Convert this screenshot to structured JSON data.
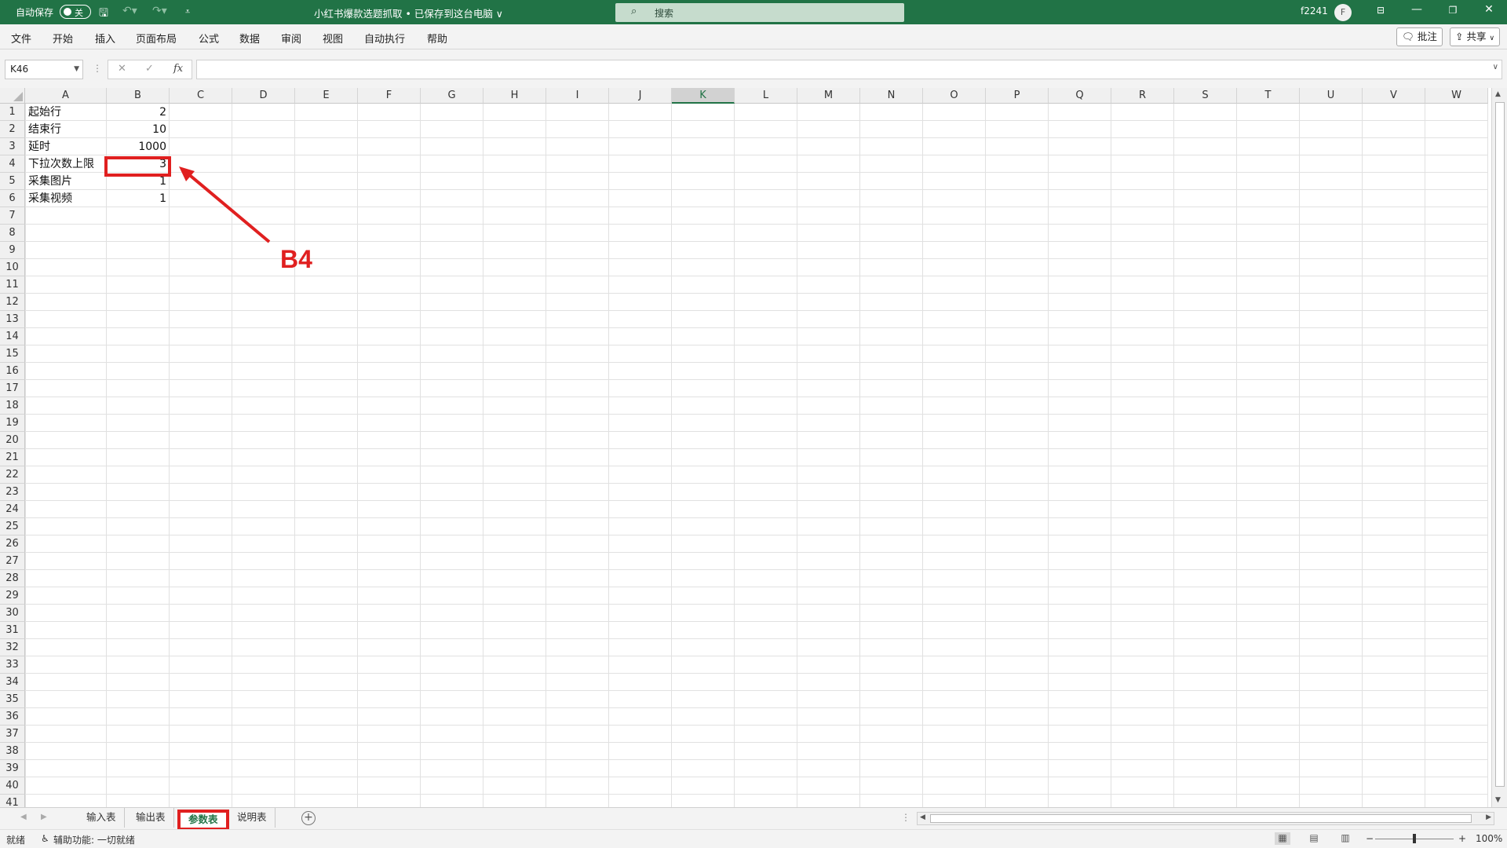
{
  "titlebar": {
    "autosave_label": "自动保存",
    "autosave_state": "关",
    "doc_title": "小红书爆款选题抓取 • 已保存到这台电脑 ∨",
    "search_placeholder": "搜索",
    "user": "f2241",
    "avatar_initial": "F"
  },
  "ribbon": {
    "tabs": [
      "文件",
      "开始",
      "插入",
      "页面布局",
      "公式",
      "数据",
      "审阅",
      "视图",
      "自动执行",
      "帮助"
    ],
    "comments_label": "批注",
    "share_label": "共享"
  },
  "formula_bar": {
    "name_box": "K46",
    "fx_label": "fx",
    "formula_value": ""
  },
  "sheet": {
    "columns": [
      "A",
      "B",
      "C",
      "D",
      "E",
      "F",
      "G",
      "H",
      "I",
      "J",
      "K",
      "L",
      "M",
      "N",
      "O",
      "P",
      "Q",
      "R",
      "S",
      "T",
      "U",
      "V",
      "W"
    ],
    "active_column": "K",
    "rows": [
      "1",
      "2",
      "3",
      "4",
      "5",
      "6",
      "7",
      "8",
      "9",
      "10",
      "11",
      "12",
      "13",
      "14",
      "15",
      "16",
      "17",
      "18",
      "19",
      "20",
      "21",
      "22",
      "23",
      "24",
      "25",
      "26",
      "27",
      "28",
      "29",
      "30",
      "31",
      "32",
      "33",
      "34",
      "35",
      "36",
      "37",
      "38",
      "39",
      "40",
      "41"
    ],
    "data": [
      {
        "label": "起始行",
        "value": "2"
      },
      {
        "label": "结束行",
        "value": "10"
      },
      {
        "label": "延时",
        "value": "1000"
      },
      {
        "label": "下拉次数上限",
        "value": "3"
      },
      {
        "label": "采集图片",
        "value": "1"
      },
      {
        "label": "采集视频",
        "value": "1"
      }
    ]
  },
  "annotation": {
    "label": "B4",
    "color": "#e02020"
  },
  "sheet_tabs": [
    {
      "label": "输入表",
      "active": false
    },
    {
      "label": "输出表",
      "active": false
    },
    {
      "label": "参数表",
      "active": true
    },
    {
      "label": "说明表",
      "active": false
    }
  ],
  "statusbar": {
    "ready": "就绪",
    "accessibility": "辅助功能: 一切就绪",
    "zoom": "100%",
    "zoom_fraction": 0.5
  },
  "colors": {
    "accent": "#217346",
    "annotation": "#e02020"
  }
}
